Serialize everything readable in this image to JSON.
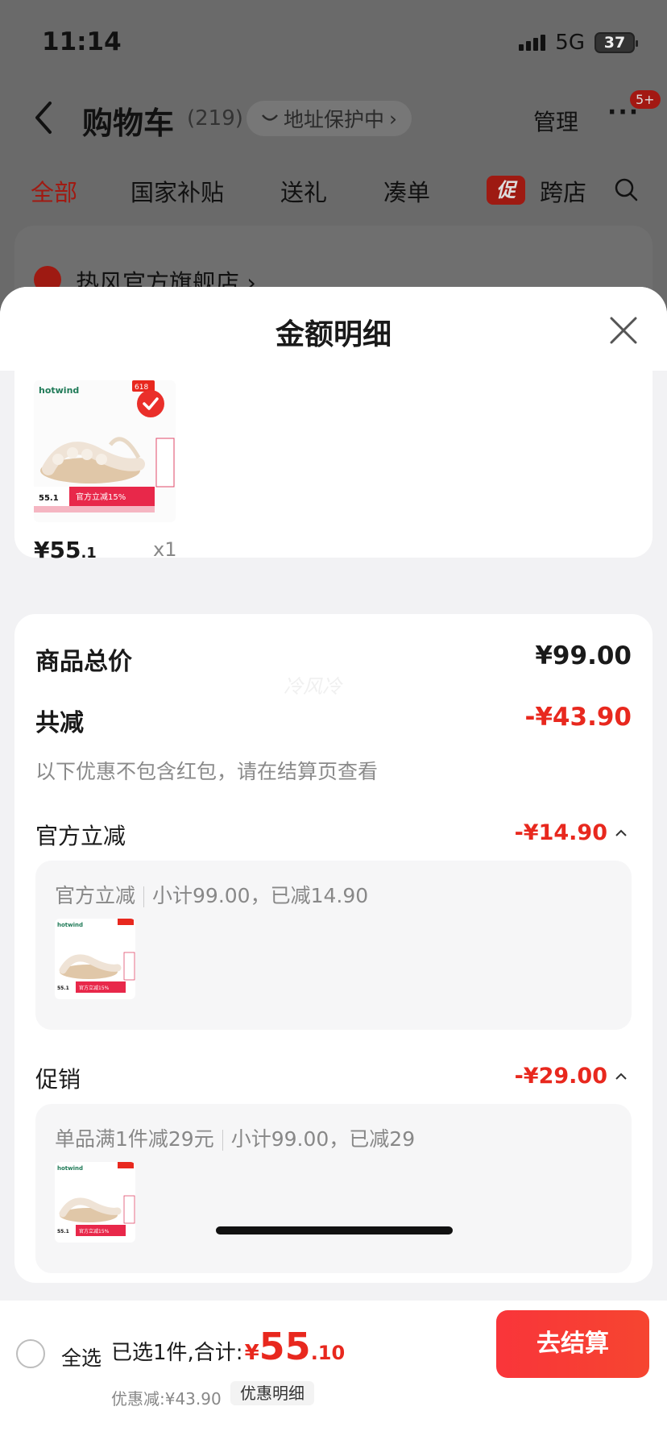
{
  "status_bar": {
    "time": "11:14",
    "network": "5G",
    "battery": "37"
  },
  "header": {
    "back_icon": "chevron-left-icon",
    "title": "购物车",
    "count": "(219)",
    "address_protect": "地址保护中",
    "manage": "管理",
    "more_badge": "5+"
  },
  "tabs": [
    "全部",
    "国家补贴",
    "送礼",
    "凑单",
    "跨店"
  ],
  "promo_tag": "促",
  "store": {
    "name": "热风官方旗舰店"
  },
  "sheet": {
    "title": "金额明细",
    "item": {
      "brand": "hotwind",
      "corner_tag": "618",
      "price_main": "¥55",
      "price_dec": ".1",
      "qty": "x1",
      "banner": "官方立减15%",
      "banner_price": "55.1"
    },
    "watermark": "冷风冷",
    "total_label": "商品总价",
    "total_value": "¥99.00",
    "reduce_label": "共减",
    "reduce_value": "-¥43.90",
    "note": "以下优惠不包含红包，请在结算页查看",
    "groups": [
      {
        "label": "官方立减",
        "value": "-¥14.90",
        "desc_a": "官方立减",
        "desc_b": "小计99.00，已减14.90"
      },
      {
        "label": "促销",
        "value": "-¥29.00",
        "desc_a": "单品满1件减29元",
        "desc_b": "小计99.00，已减29"
      }
    ]
  },
  "footer": {
    "select_all": "全选",
    "selected": "已选1件,合计:",
    "currency": "¥",
    "total_main": "55",
    "total_dec": ".10",
    "discount": "优惠减:¥43.90",
    "discount_detail": "优惠明细",
    "checkout": "去结算"
  },
  "colors": {
    "accent": "#e8281e",
    "checkout": "#f9353a",
    "sheet_bg": "#f2f2f4"
  }
}
